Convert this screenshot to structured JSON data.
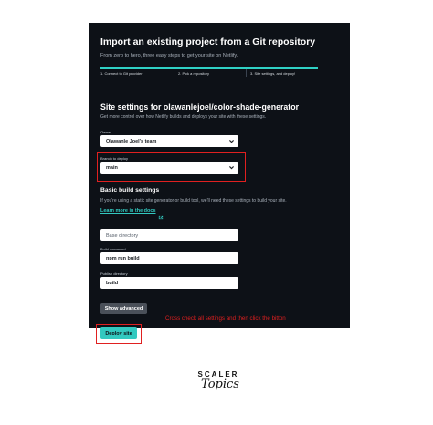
{
  "header": {
    "title": "Import an existing project from a Git repository",
    "subtitle": "From zero to hero, three easy steps to get your site on Netlify."
  },
  "steps": {
    "progress": 1.0,
    "items": [
      {
        "label": "1. Connect to Git provider"
      },
      {
        "label": "2. Pick a repository"
      },
      {
        "label": "3. Site settings, and deploy!"
      }
    ]
  },
  "site_settings": {
    "title": "Site settings for olawanlejoel/color-shade-generator",
    "subtitle": "Get more control over how Netlify builds and deploys your site with these settings.",
    "owner_label": "Owner",
    "owner_value": "Olawanle Joel's team",
    "branch_label": "Branch to deploy",
    "branch_value": "main"
  },
  "build_settings": {
    "title": "Basic build settings",
    "subtitle": "If you're using a static site generator or build tool, we'll need these settings to build your site.",
    "docs_link": "Learn more in the docs",
    "base_directory_placeholder": "Base directory",
    "build_command_label": "Build command",
    "build_command_value": "npm run build",
    "publish_directory_label": "Publish directory",
    "publish_directory_value": "build",
    "show_advanced": "Show advanced"
  },
  "annotation": "Cross check all settings and then click the bitton",
  "deploy_button": "Deploy site",
  "logo": {
    "top": "SCALER",
    "bottom": "Topics"
  },
  "colors": {
    "panel_bg": "#0d1117",
    "accent": "#32c9c0",
    "highlight_red": "#e02020"
  }
}
